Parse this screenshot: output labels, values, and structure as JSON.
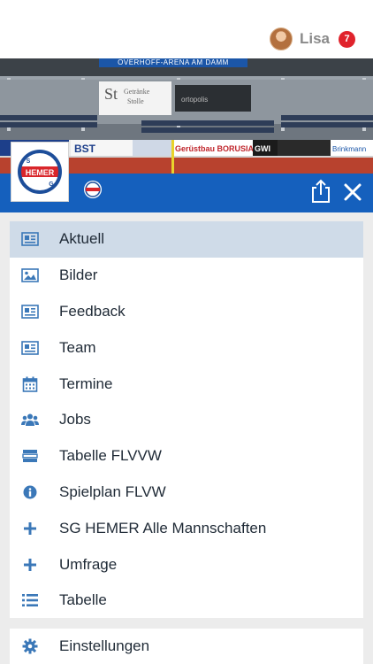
{
  "header": {
    "user_name": "Lisa",
    "notification_count": "7"
  },
  "banner": {
    "arena_name": "OVERHOFF-ARENA AM DAMM"
  },
  "club": {
    "logo_text": "HEMER",
    "logo_letter_top": "S",
    "logo_letter_bottom": "G"
  },
  "menu": {
    "items": [
      {
        "label": "Aktuell",
        "icon": "newspaper-icon",
        "active": true
      },
      {
        "label": "Bilder",
        "icon": "image-icon",
        "active": false
      },
      {
        "label": "Feedback",
        "icon": "newspaper-icon",
        "active": false
      },
      {
        "label": "Team",
        "icon": "newspaper-icon",
        "active": false
      },
      {
        "label": "Termine",
        "icon": "calendar-icon",
        "active": false
      },
      {
        "label": "Jobs",
        "icon": "users-icon",
        "active": false
      },
      {
        "label": "Tabelle FLVVW",
        "icon": "table-rows-icon",
        "active": false
      },
      {
        "label": "Spielplan FLVW",
        "icon": "info-icon",
        "active": false
      },
      {
        "label": "SG HEMER Alle Mannschaften",
        "icon": "plus-icon",
        "active": false
      },
      {
        "label": "Umfrage",
        "icon": "plus-icon",
        "active": false
      },
      {
        "label": "Tabelle",
        "icon": "list-icon",
        "active": false
      }
    ]
  },
  "footer_menu": {
    "settings_label": "Einstellungen",
    "settings_icon": "gear-icon"
  },
  "colors": {
    "brand_blue": "#1560bd",
    "active_row": "#cfdbe8",
    "badge_red": "#e0232c",
    "icon_blue": "#3b78b8"
  }
}
